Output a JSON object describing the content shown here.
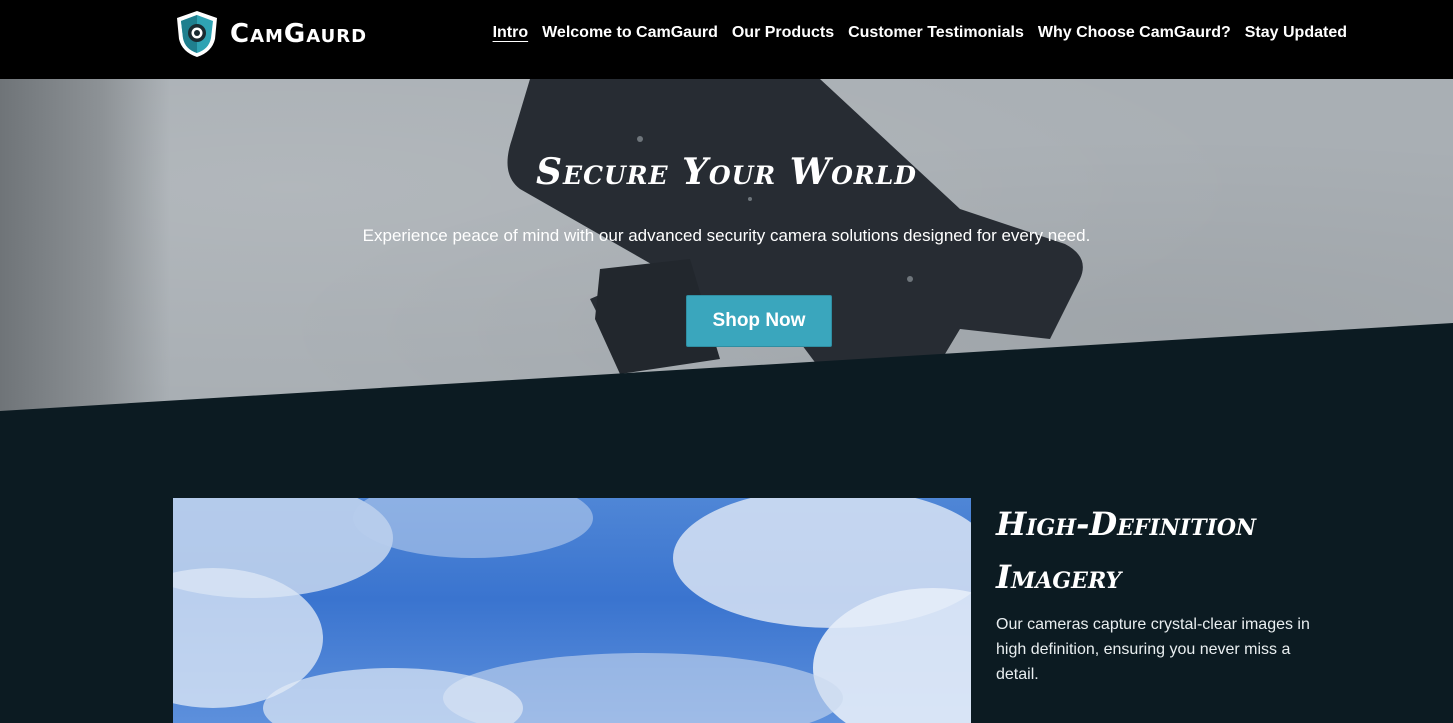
{
  "brand": {
    "name": "CamGaurd",
    "logo_icon": "shield-camera-icon",
    "colors": {
      "header_bg": "#000000",
      "accent": "#3aa6bd",
      "dark_bg": "#0c1b22",
      "shield_teal": "#2fa3b3"
    }
  },
  "nav": {
    "items": [
      {
        "label": "Intro",
        "active": true
      },
      {
        "label": "Welcome to CamGaurd",
        "active": false
      },
      {
        "label": "Our Products",
        "active": false
      },
      {
        "label": "Customer Testimonials",
        "active": false
      },
      {
        "label": "Why Choose CamGaurd?",
        "active": false
      },
      {
        "label": "Stay Updated",
        "active": false
      }
    ]
  },
  "hero": {
    "title": "Secure Your World",
    "subtitle": "Experience peace of mind with our advanced security camera solutions designed for every need.",
    "cta_label": "Shop Now",
    "background_icon": "security-camera-graffiti"
  },
  "feature": {
    "title": "High-Definition Imagery",
    "description": "Our cameras capture crystal-clear images in high definition, ensuring you never miss a detail.",
    "image": "blue-sky-clouds"
  }
}
